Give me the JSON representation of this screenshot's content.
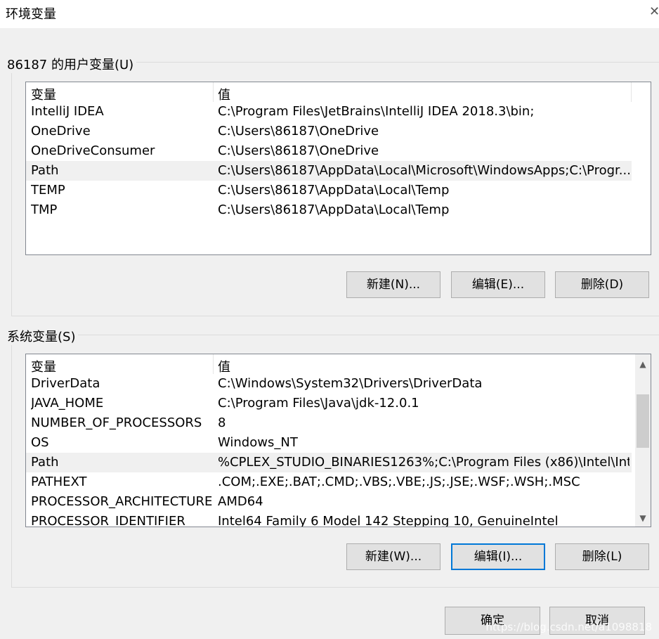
{
  "window": {
    "title": "环境变量",
    "close_icon": "close-icon"
  },
  "user_vars": {
    "label": "86187 的用户变量(U)",
    "col_name": "变量",
    "col_value": "值",
    "rows": [
      {
        "name": "IntelliJ IDEA",
        "value": "C:\\Program Files\\JetBrains\\IntelliJ IDEA 2018.3\\bin;"
      },
      {
        "name": "OneDrive",
        "value": "C:\\Users\\86187\\OneDrive"
      },
      {
        "name": "OneDriveConsumer",
        "value": "C:\\Users\\86187\\OneDrive"
      },
      {
        "name": "Path",
        "value": "C:\\Users\\86187\\AppData\\Local\\Microsoft\\WindowsApps;C:\\Progr..."
      },
      {
        "name": "TEMP",
        "value": "C:\\Users\\86187\\AppData\\Local\\Temp"
      },
      {
        "name": "TMP",
        "value": "C:\\Users\\86187\\AppData\\Local\\Temp"
      }
    ],
    "selected_index": 3,
    "buttons": {
      "new": "新建(N)...",
      "edit": "编辑(E)...",
      "delete": "删除(D)"
    }
  },
  "system_vars": {
    "label": "系统变量(S)",
    "col_name": "变量",
    "col_value": "值",
    "rows": [
      {
        "name": "DriverData",
        "value": "C:\\Windows\\System32\\Drivers\\DriverData"
      },
      {
        "name": "JAVA_HOME",
        "value": "C:\\Program Files\\Java\\jdk-12.0.1"
      },
      {
        "name": "NUMBER_OF_PROCESSORS",
        "value": "8"
      },
      {
        "name": "OS",
        "value": "Windows_NT"
      },
      {
        "name": "Path",
        "value": "%CPLEX_STUDIO_BINARIES1263%;C:\\Program Files (x86)\\Intel\\Int..."
      },
      {
        "name": "PATHEXT",
        "value": ".COM;.EXE;.BAT;.CMD;.VBS;.VBE;.JS;.JSE;.WSF;.WSH;.MSC"
      },
      {
        "name": "PROCESSOR_ARCHITECTURE",
        "value": "AMD64"
      },
      {
        "name": "PROCESSOR_IDENTIFIER",
        "value": "Intel64 Family 6 Model 142 Stepping 10, GenuineIntel"
      }
    ],
    "selected_index": 4,
    "scroll_up_icon": "chevron-up-icon",
    "scroll_down_icon": "chevron-down-icon",
    "buttons": {
      "new": "新建(W)...",
      "edit": "编辑(I)...",
      "delete": "删除(L)"
    }
  },
  "footer": {
    "ok": "确定",
    "cancel": "取消"
  },
  "watermark": "https://blog.csdn.net/a1098818"
}
